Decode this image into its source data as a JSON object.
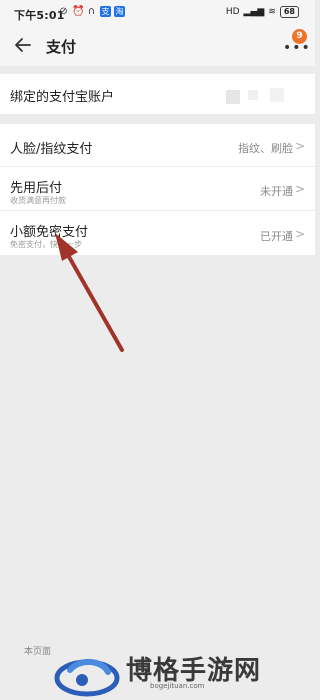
{
  "status_bar": {
    "time": "下午5:01",
    "battery": "68",
    "network": "HD"
  },
  "header": {
    "title": "支付",
    "badge": "9"
  },
  "alipay_row": {
    "label": "绑定的支付宝账户"
  },
  "rows": [
    {
      "title": "人脸/指纹支付",
      "value": "指纹、刷脸"
    },
    {
      "title": "先用后付",
      "subtitle": "收货满意再付款",
      "value": "未开通"
    },
    {
      "title": "小额免密支付",
      "subtitle": "免密支付，快人一步",
      "value": "已开通"
    }
  ],
  "footer": {
    "text": "本页面"
  },
  "watermark": {
    "name": "博格手游网",
    "url": "bogejituan.com"
  },
  "colors": {
    "arrow": "#a0342a",
    "badge": "#f0732b",
    "background": "#ececec"
  }
}
